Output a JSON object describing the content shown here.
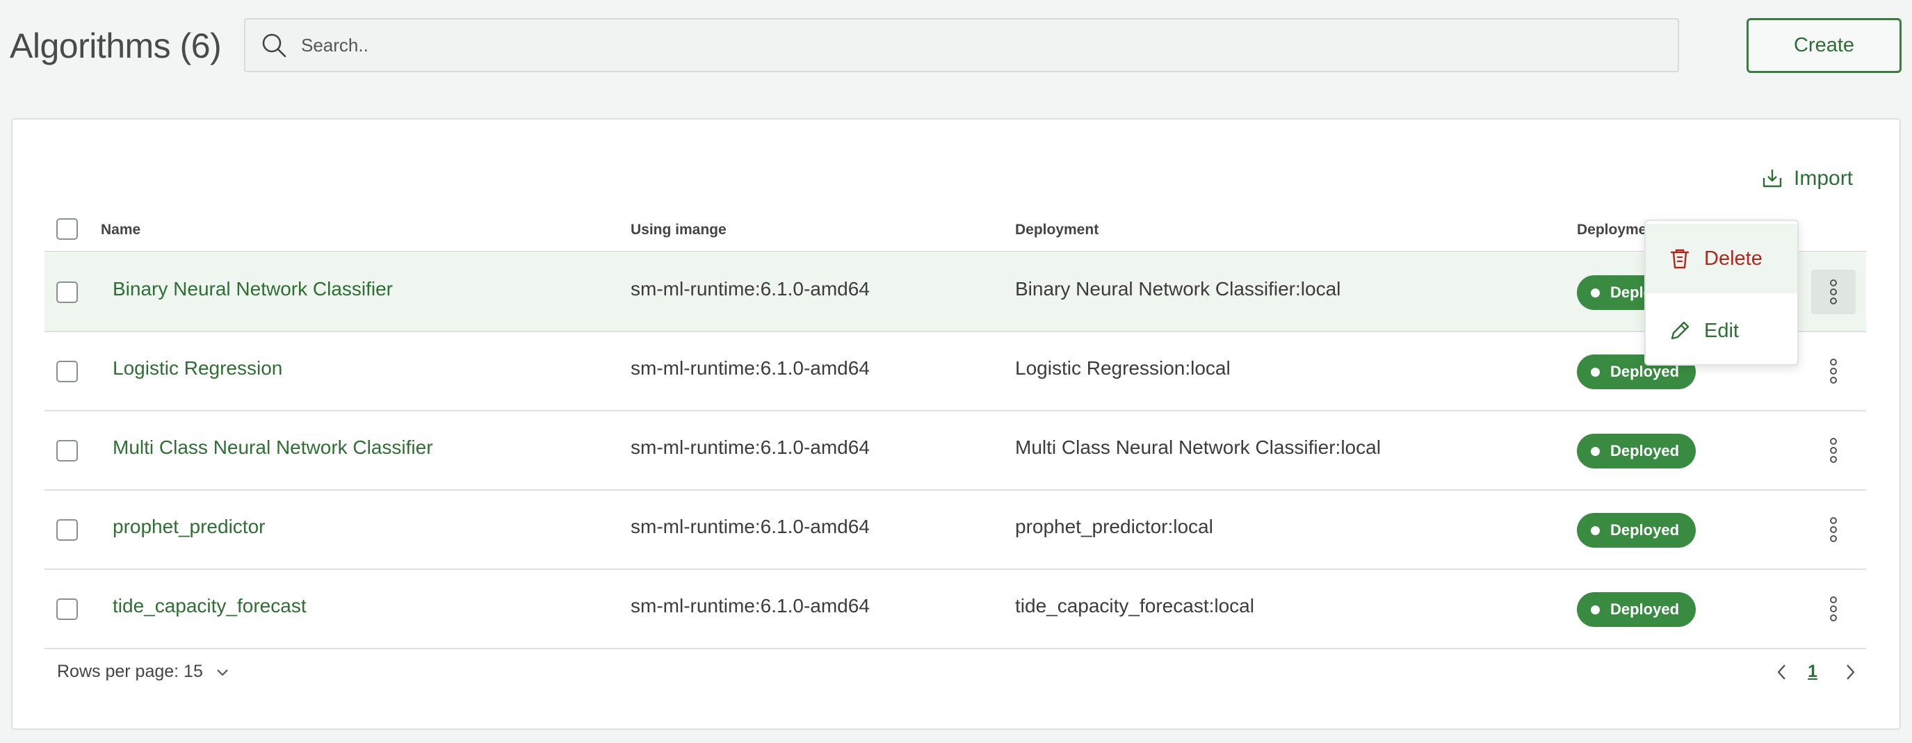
{
  "header": {
    "title": "Algorithms (6)",
    "search_placeholder": "Search..",
    "create_label": "Create"
  },
  "toolbar": {
    "import_label": "Import"
  },
  "table": {
    "columns": [
      "Name",
      "Using imange",
      "Deployment",
      "Deployme"
    ],
    "rows": [
      {
        "name": "Binary Neural Network Classifier",
        "image": "sm-ml-runtime:6.1.0-amd64",
        "deployment": "Binary Neural Network Classifier:local",
        "status": "Deployed"
      },
      {
        "name": "Logistic Regression",
        "image": "sm-ml-runtime:6.1.0-amd64",
        "deployment": "Logistic Regression:local",
        "status": "Deployed"
      },
      {
        "name": "Multi Class Neural Network Classifier",
        "image": "sm-ml-runtime:6.1.0-amd64",
        "deployment": "Multi Class Neural Network Classifier:local",
        "status": "Deployed"
      },
      {
        "name": "prophet_predictor",
        "image": "sm-ml-runtime:6.1.0-amd64",
        "deployment": "prophet_predictor:local",
        "status": "Deployed"
      },
      {
        "name": "tide_capacity_forecast",
        "image": "sm-ml-runtime:6.1.0-amd64",
        "deployment": "tide_capacity_forecast:local",
        "status": "Deployed"
      }
    ],
    "first_row_status_visible": "Deplo"
  },
  "menu": {
    "delete_label": "Delete",
    "edit_label": "Edit"
  },
  "footer": {
    "rows_per_page": "Rows per page: 15",
    "current_page": "1"
  },
  "colors": {
    "accent": "#2e6f33",
    "badge": "#3a8b42",
    "danger": "#b3261e"
  }
}
